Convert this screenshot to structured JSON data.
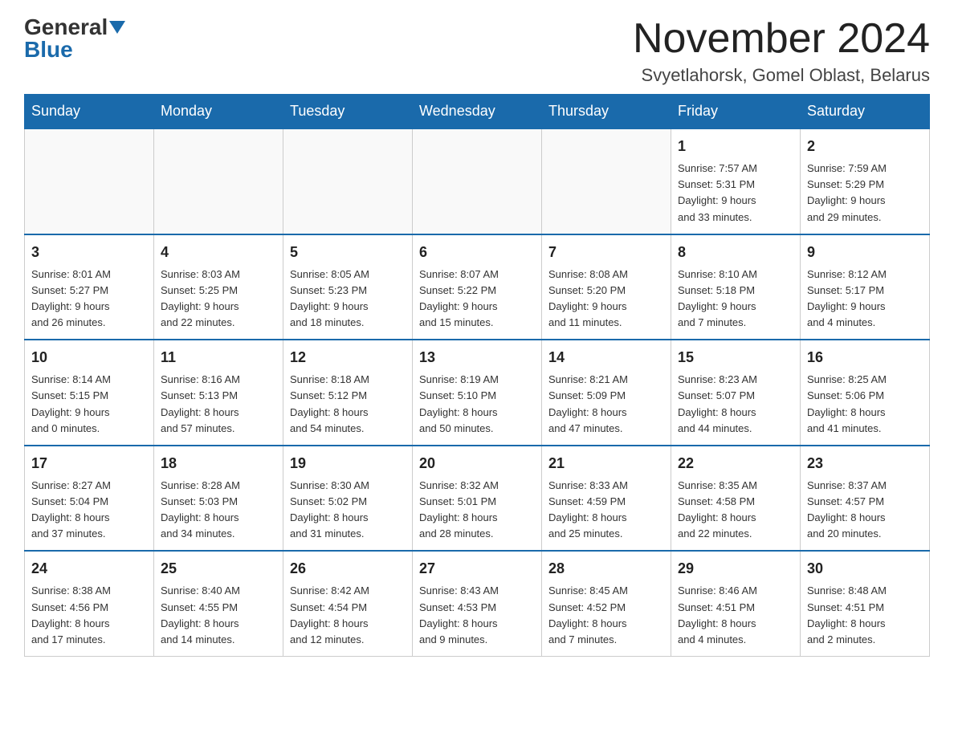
{
  "logo": {
    "general": "General",
    "blue": "Blue"
  },
  "title": "November 2024",
  "subtitle": "Svyetlahorsk, Gomel Oblast, Belarus",
  "header": {
    "days": [
      "Sunday",
      "Monday",
      "Tuesday",
      "Wednesday",
      "Thursday",
      "Friday",
      "Saturday"
    ]
  },
  "weeks": [
    [
      {
        "day": "",
        "info": ""
      },
      {
        "day": "",
        "info": ""
      },
      {
        "day": "",
        "info": ""
      },
      {
        "day": "",
        "info": ""
      },
      {
        "day": "",
        "info": ""
      },
      {
        "day": "1",
        "info": "Sunrise: 7:57 AM\nSunset: 5:31 PM\nDaylight: 9 hours\nand 33 minutes."
      },
      {
        "day": "2",
        "info": "Sunrise: 7:59 AM\nSunset: 5:29 PM\nDaylight: 9 hours\nand 29 minutes."
      }
    ],
    [
      {
        "day": "3",
        "info": "Sunrise: 8:01 AM\nSunset: 5:27 PM\nDaylight: 9 hours\nand 26 minutes."
      },
      {
        "day": "4",
        "info": "Sunrise: 8:03 AM\nSunset: 5:25 PM\nDaylight: 9 hours\nand 22 minutes."
      },
      {
        "day": "5",
        "info": "Sunrise: 8:05 AM\nSunset: 5:23 PM\nDaylight: 9 hours\nand 18 minutes."
      },
      {
        "day": "6",
        "info": "Sunrise: 8:07 AM\nSunset: 5:22 PM\nDaylight: 9 hours\nand 15 minutes."
      },
      {
        "day": "7",
        "info": "Sunrise: 8:08 AM\nSunset: 5:20 PM\nDaylight: 9 hours\nand 11 minutes."
      },
      {
        "day": "8",
        "info": "Sunrise: 8:10 AM\nSunset: 5:18 PM\nDaylight: 9 hours\nand 7 minutes."
      },
      {
        "day": "9",
        "info": "Sunrise: 8:12 AM\nSunset: 5:17 PM\nDaylight: 9 hours\nand 4 minutes."
      }
    ],
    [
      {
        "day": "10",
        "info": "Sunrise: 8:14 AM\nSunset: 5:15 PM\nDaylight: 9 hours\nand 0 minutes."
      },
      {
        "day": "11",
        "info": "Sunrise: 8:16 AM\nSunset: 5:13 PM\nDaylight: 8 hours\nand 57 minutes."
      },
      {
        "day": "12",
        "info": "Sunrise: 8:18 AM\nSunset: 5:12 PM\nDaylight: 8 hours\nand 54 minutes."
      },
      {
        "day": "13",
        "info": "Sunrise: 8:19 AM\nSunset: 5:10 PM\nDaylight: 8 hours\nand 50 minutes."
      },
      {
        "day": "14",
        "info": "Sunrise: 8:21 AM\nSunset: 5:09 PM\nDaylight: 8 hours\nand 47 minutes."
      },
      {
        "day": "15",
        "info": "Sunrise: 8:23 AM\nSunset: 5:07 PM\nDaylight: 8 hours\nand 44 minutes."
      },
      {
        "day": "16",
        "info": "Sunrise: 8:25 AM\nSunset: 5:06 PM\nDaylight: 8 hours\nand 41 minutes."
      }
    ],
    [
      {
        "day": "17",
        "info": "Sunrise: 8:27 AM\nSunset: 5:04 PM\nDaylight: 8 hours\nand 37 minutes."
      },
      {
        "day": "18",
        "info": "Sunrise: 8:28 AM\nSunset: 5:03 PM\nDaylight: 8 hours\nand 34 minutes."
      },
      {
        "day": "19",
        "info": "Sunrise: 8:30 AM\nSunset: 5:02 PM\nDaylight: 8 hours\nand 31 minutes."
      },
      {
        "day": "20",
        "info": "Sunrise: 8:32 AM\nSunset: 5:01 PM\nDaylight: 8 hours\nand 28 minutes."
      },
      {
        "day": "21",
        "info": "Sunrise: 8:33 AM\nSunset: 4:59 PM\nDaylight: 8 hours\nand 25 minutes."
      },
      {
        "day": "22",
        "info": "Sunrise: 8:35 AM\nSunset: 4:58 PM\nDaylight: 8 hours\nand 22 minutes."
      },
      {
        "day": "23",
        "info": "Sunrise: 8:37 AM\nSunset: 4:57 PM\nDaylight: 8 hours\nand 20 minutes."
      }
    ],
    [
      {
        "day": "24",
        "info": "Sunrise: 8:38 AM\nSunset: 4:56 PM\nDaylight: 8 hours\nand 17 minutes."
      },
      {
        "day": "25",
        "info": "Sunrise: 8:40 AM\nSunset: 4:55 PM\nDaylight: 8 hours\nand 14 minutes."
      },
      {
        "day": "26",
        "info": "Sunrise: 8:42 AM\nSunset: 4:54 PM\nDaylight: 8 hours\nand 12 minutes."
      },
      {
        "day": "27",
        "info": "Sunrise: 8:43 AM\nSunset: 4:53 PM\nDaylight: 8 hours\nand 9 minutes."
      },
      {
        "day": "28",
        "info": "Sunrise: 8:45 AM\nSunset: 4:52 PM\nDaylight: 8 hours\nand 7 minutes."
      },
      {
        "day": "29",
        "info": "Sunrise: 8:46 AM\nSunset: 4:51 PM\nDaylight: 8 hours\nand 4 minutes."
      },
      {
        "day": "30",
        "info": "Sunrise: 8:48 AM\nSunset: 4:51 PM\nDaylight: 8 hours\nand 2 minutes."
      }
    ]
  ]
}
